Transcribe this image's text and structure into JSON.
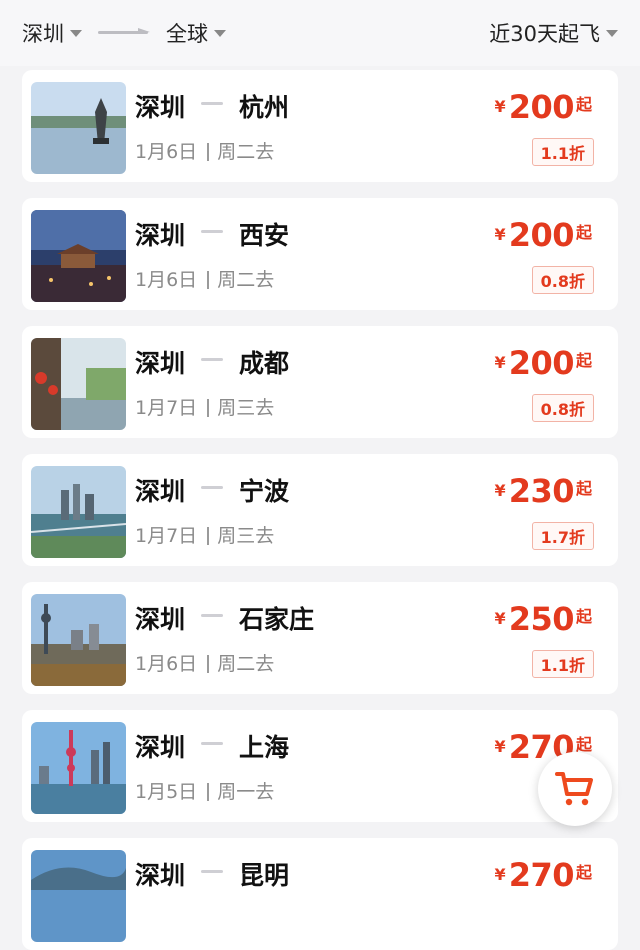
{
  "header": {
    "origin": "深圳",
    "destination": "全球",
    "date_range": "近30天起飞"
  },
  "currency_symbol": "¥",
  "price_suffix": "起",
  "flights": [
    {
      "from": "深圳",
      "to": "杭州",
      "date": "1月6日",
      "weekday": "周二去",
      "price": "200",
      "discount": "1.1折"
    },
    {
      "from": "深圳",
      "to": "西安",
      "date": "1月6日",
      "weekday": "周二去",
      "price": "200",
      "discount": "0.8折"
    },
    {
      "from": "深圳",
      "to": "成都",
      "date": "1月7日",
      "weekday": "周三去",
      "price": "200",
      "discount": "0.8折"
    },
    {
      "from": "深圳",
      "to": "宁波",
      "date": "1月7日",
      "weekday": "周三去",
      "price": "230",
      "discount": "1.7折"
    },
    {
      "from": "深圳",
      "to": "石家庄",
      "date": "1月6日",
      "weekday": "周二去",
      "price": "250",
      "discount": "1.1折"
    },
    {
      "from": "深圳",
      "to": "上海",
      "date": "1月5日",
      "weekday": "周一去",
      "price": "270",
      "discount": ""
    },
    {
      "from": "深圳",
      "to": "昆明",
      "date": "",
      "weekday": "",
      "price": "270",
      "discount": ""
    }
  ],
  "colors": {
    "accent": "#e33a1e",
    "background": "#f3f3f5",
    "card": "#ffffff"
  },
  "icons": {
    "cart": "shopping-cart-icon",
    "dropdown": "triangle-down-icon"
  }
}
